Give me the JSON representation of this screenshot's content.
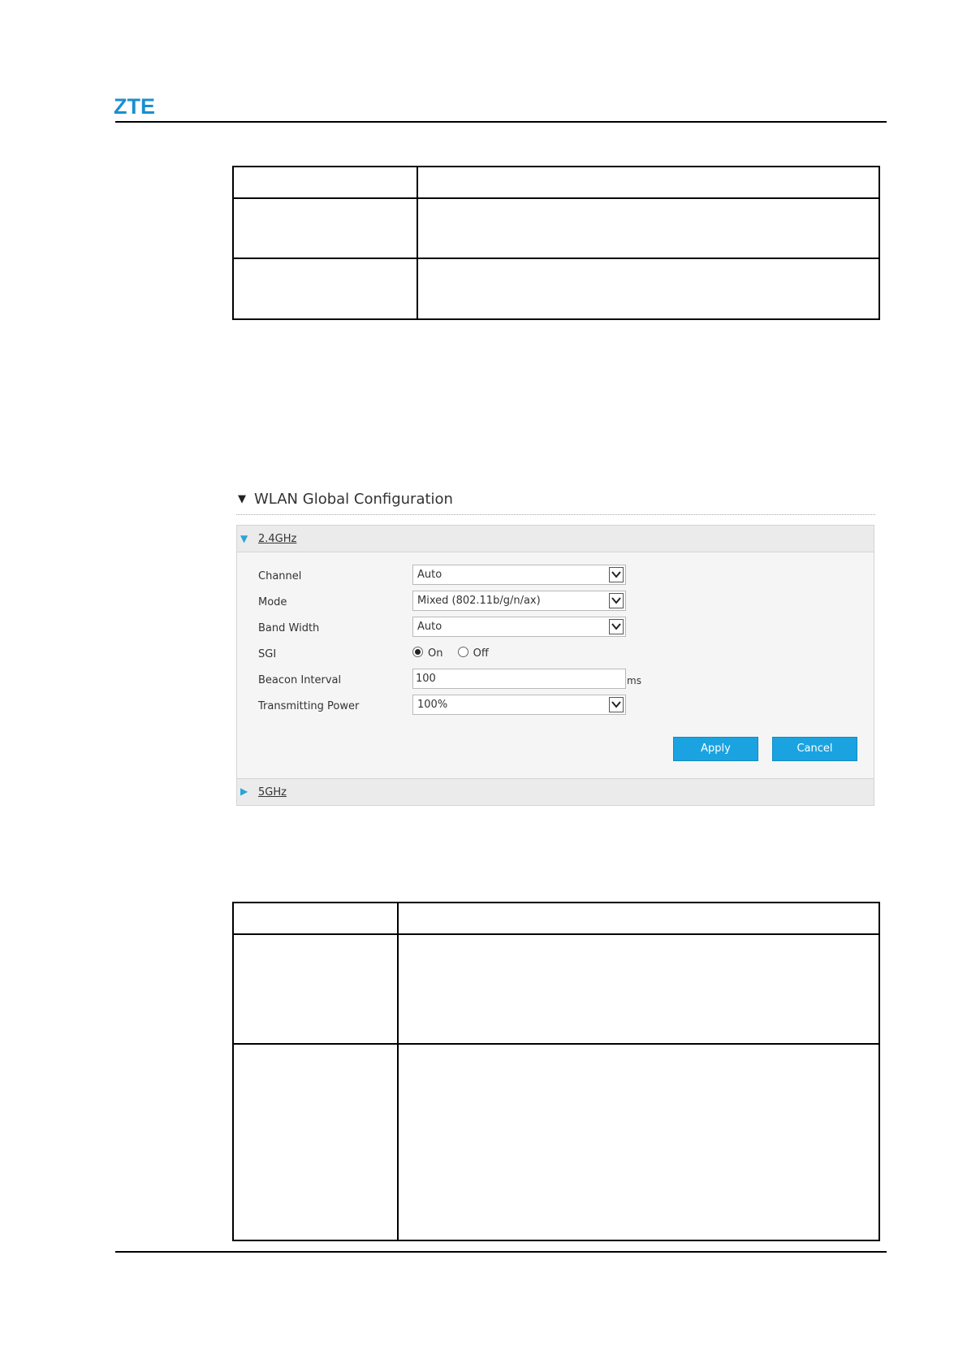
{
  "header": {
    "logo_text": "ZTE"
  },
  "wlan": {
    "section_title": "WLAN Global Configuration",
    "band_24": {
      "label": "2.4GHz"
    },
    "band_5": {
      "label": "5GHz"
    },
    "fields": {
      "channel": {
        "label": "Channel",
        "value": "Auto"
      },
      "mode": {
        "label": "Mode",
        "value": "Mixed (802.11b/g/n/ax)"
      },
      "band_width": {
        "label": "Band Width",
        "value": "Auto"
      },
      "sgi": {
        "label": "SGI",
        "on_label": "On",
        "off_label": "Off",
        "selected": "On"
      },
      "beacon_interval": {
        "label": "Beacon Interval",
        "value": "100",
        "unit": "ms"
      },
      "transmitting_power": {
        "label": "Transmitting Power",
        "value": "100%"
      }
    },
    "buttons": {
      "apply": "Apply",
      "cancel": "Cancel"
    }
  }
}
